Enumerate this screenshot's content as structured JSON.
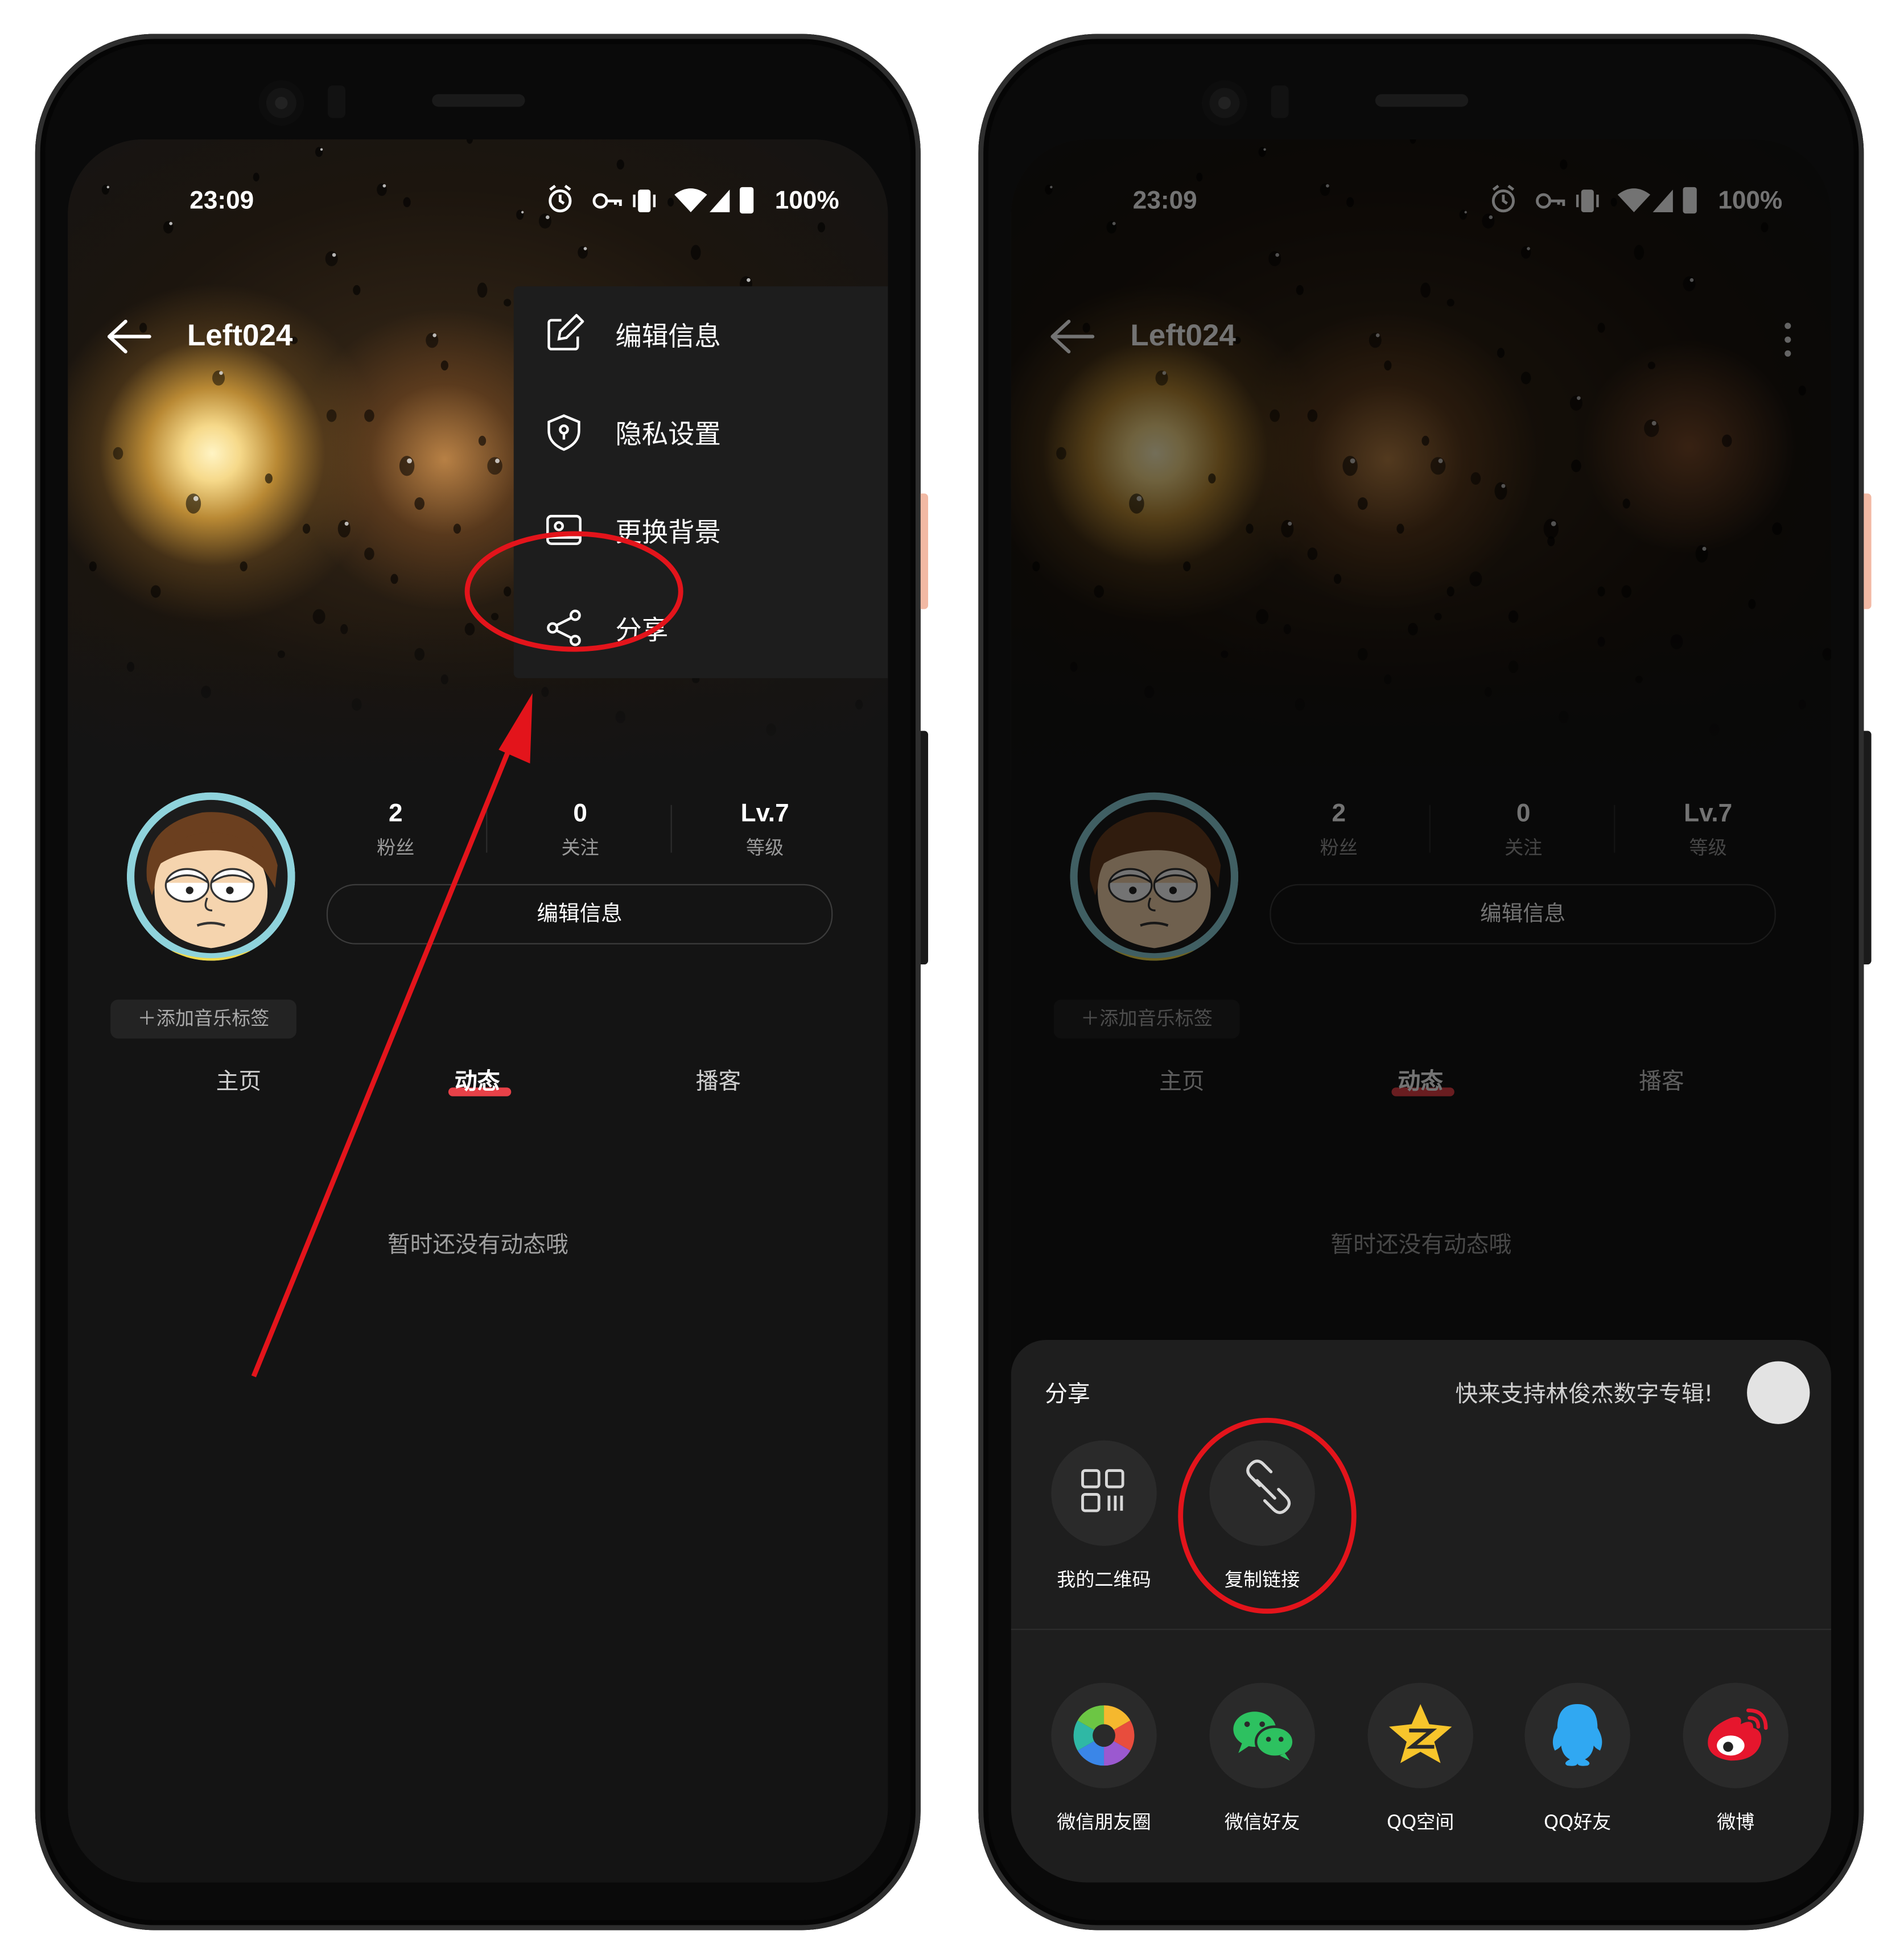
{
  "status_bar": {
    "time": "23:09",
    "battery": "100%"
  },
  "profile": {
    "username": "Left024",
    "stats": [
      {
        "value": "2",
        "label": "粉丝"
      },
      {
        "value": "0",
        "label": "关注"
      },
      {
        "value": "Lv.7",
        "label": "等级"
      }
    ],
    "edit_button": "编辑信息",
    "add_tag_button": "＋添加音乐标签",
    "tabs": [
      "主页",
      "动态",
      "播客"
    ],
    "active_tab": "动态",
    "empty_message": "暂时还没有动态哦"
  },
  "overflow_menu": {
    "items": [
      {
        "label": "编辑信息",
        "icon": "edit-icon"
      },
      {
        "label": "隐私设置",
        "icon": "shield-lock-icon"
      },
      {
        "label": "更换背景",
        "icon": "image-card-icon"
      },
      {
        "label": "分享",
        "icon": "share-icon"
      }
    ]
  },
  "share_sheet": {
    "title": "分享",
    "promo_text": "快来支持林俊杰数字专辑!",
    "top_options": [
      {
        "label": "我的二维码",
        "icon": "qr-code-icon"
      },
      {
        "label": "复制链接",
        "icon": "link-icon"
      }
    ],
    "platforms": [
      {
        "label": "微信朋友圈",
        "icon": "moments-icon"
      },
      {
        "label": "微信好友",
        "icon": "wechat-icon"
      },
      {
        "label": "QQ空间",
        "icon": "qzone-icon"
      },
      {
        "label": "QQ好友",
        "icon": "qq-icon"
      },
      {
        "label": "微博",
        "icon": "weibo-icon"
      }
    ]
  },
  "colors": {
    "accent": "#e84148",
    "annotation": "#e3141b",
    "background": "#141414",
    "sheet": "#1e1e1e"
  }
}
